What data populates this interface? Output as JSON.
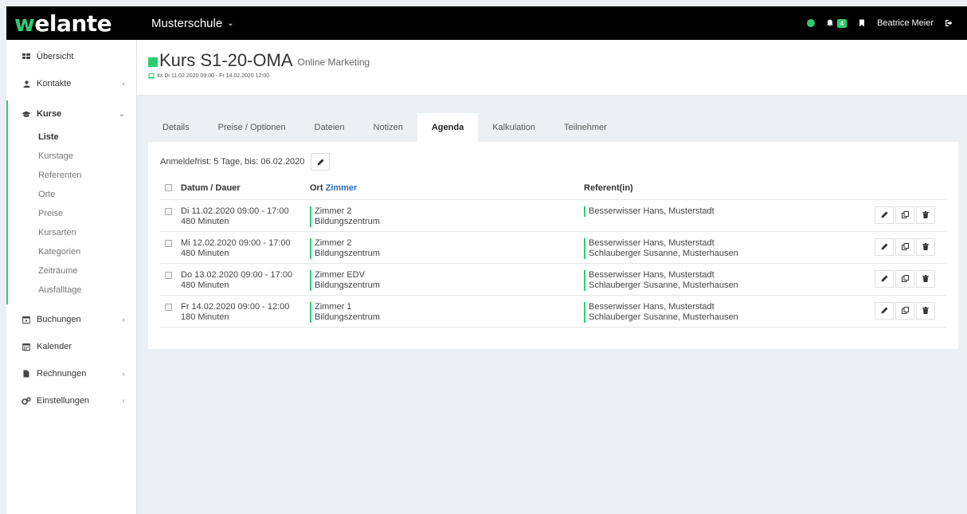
{
  "app": {
    "logo_prefix": "w",
    "logo_rest": "elante",
    "school": "Musterschule",
    "notification_count": "4",
    "user": "Beatrice Meier"
  },
  "sidebar": {
    "overview": "Übersicht",
    "contacts": "Kontakte",
    "courses": "Kurse",
    "course_items": [
      "Liste",
      "Kurstage",
      "Referenten",
      "Orte",
      "Preise",
      "Kursarten",
      "Kategorien",
      "Zeiträume",
      "Ausfalltage"
    ],
    "bookings": "Buchungen",
    "calendar": "Kalender",
    "invoices": "Rechnungen",
    "settings": "Einstellungen"
  },
  "course": {
    "title": "Kurs S1-20-OMA",
    "subtitle": "Online Marketing",
    "dates": "4x Di 11.02.2020 09:00 - Fr 14.02.2020 12:00"
  },
  "tabs": [
    "Details",
    "Preise / Optionen",
    "Dateien",
    "Notizen",
    "Agenda",
    "Kalkulation",
    "Teilnehmer"
  ],
  "agenda": {
    "deadline": "Anmeldefrist: 5 Tage, bis: 06.02.2020",
    "headers": {
      "date": "Datum / Dauer",
      "place_prefix": "Ort",
      "place_room": "Zimmer",
      "referent": "Referent(in)"
    },
    "rows": [
      {
        "date": "Di 11.02.2020 09:00 - 17:00",
        "duration": "480 Minuten",
        "room": "Zimmer 2",
        "place": "Bildungszentrum",
        "refs": [
          "Besserwisser Hans, Musterstadt"
        ]
      },
      {
        "date": "Mi 12.02.2020 09:00 - 17:00",
        "duration": "480 Minuten",
        "room": "Zimmer 2",
        "place": "Bildungszentrum",
        "refs": [
          "Besserwisser Hans, Musterstadt",
          "Schlauberger Susanne, Musterhausen"
        ]
      },
      {
        "date": "Do 13.02.2020 09:00 - 17:00",
        "duration": "480 Minuten",
        "room": "Zimmer EDV",
        "place": "Bildungszentrum",
        "refs": [
          "Besserwisser Hans, Musterstadt",
          "Schlauberger Susanne, Musterhausen"
        ]
      },
      {
        "date": "Fr 14.02.2020 09:00 - 12:00",
        "duration": "180 Minuten",
        "room": "Zimmer 1",
        "place": "Bildungszentrum",
        "refs": [
          "Besserwisser Hans, Musterstadt",
          "Schlauberger Susanne, Musterhausen"
        ]
      }
    ]
  },
  "colors": {
    "accent": "#2ecc71",
    "topbar": "#000000",
    "link": "#2a6fb5"
  }
}
